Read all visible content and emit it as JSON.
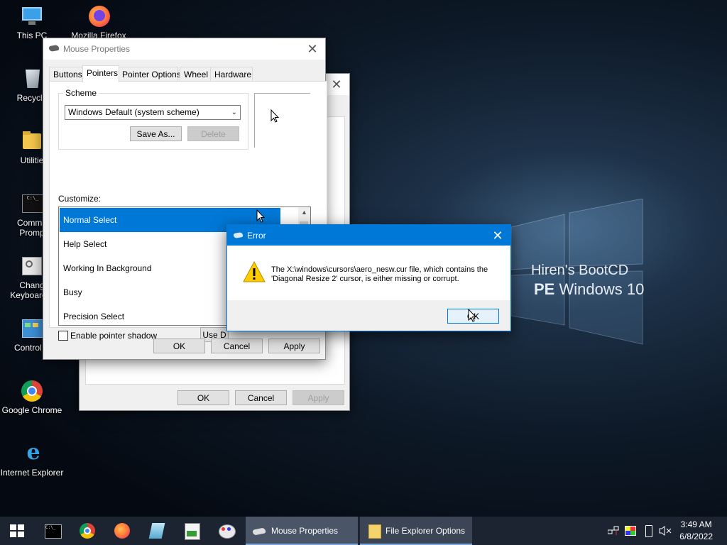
{
  "desktop": {
    "icons": [
      {
        "label": "This PC",
        "icon": "this-pc-icon"
      },
      {
        "label": "Mozilla Firefox",
        "icon": "firefox-icon"
      },
      {
        "label": "Recycle",
        "icon": "recycle-bin-icon"
      },
      {
        "label": "Utilitie",
        "icon": "folder-icon"
      },
      {
        "label": "Comma",
        "label2": "Promp",
        "icon": "command-prompt-icon"
      },
      {
        "label": "Chang",
        "label2": "Keyboard L",
        "icon": "keyboard-layout-icon"
      },
      {
        "label": "Control P",
        "icon": "control-panel-icon"
      },
      {
        "label": "Google Chrome",
        "icon": "chrome-icon"
      },
      {
        "label": "Internet Explorer",
        "icon": "ie-icon"
      }
    ],
    "branding": {
      "line1": "Hiren's BootCD",
      "line2_bold": "PE",
      "line2_rest": " Windows 10"
    }
  },
  "back_window": {
    "buttons": {
      "ok": "OK",
      "cancel": "Cancel",
      "apply": "Apply"
    }
  },
  "mouse_props": {
    "title": "Mouse Properties",
    "tabs": [
      "Buttons",
      "Pointers",
      "Pointer Options",
      "Wheel",
      "Hardware"
    ],
    "active_tab": "Pointers",
    "scheme_label": "Scheme",
    "scheme_value": "Windows Default (system scheme)",
    "save_as": "Save As...",
    "delete": "Delete",
    "customize_label": "Customize:",
    "list": [
      {
        "label": "Normal Select",
        "selected": true
      },
      {
        "label": "Help Select",
        "selected": false
      },
      {
        "label": "Working In Background",
        "selected": false
      },
      {
        "label": "Busy",
        "selected": false
      },
      {
        "label": "Precision Select",
        "selected": false
      }
    ],
    "enable_shadow": "Enable pointer shadow",
    "use_default": "Use D",
    "buttons": {
      "ok": "OK",
      "cancel": "Cancel",
      "apply": "Apply"
    }
  },
  "error_dialog": {
    "title": "Error",
    "message": "The X:\\windows\\cursors\\aero_nesw.cur file, which contains the 'Diagonal Resize 2' cursor, is either missing or corrupt.",
    "ok": "OK"
  },
  "taskbar": {
    "pinned": [
      "start-icon",
      "cmd-icon",
      "chrome-icon",
      "firefox-icon",
      "notepad-icon",
      "task-manager-icon",
      "paint-icon"
    ],
    "buttons": [
      {
        "label": "Mouse Properties",
        "icon": "mouse-icon"
      },
      {
        "label": "File Explorer Options",
        "icon": "folder-options-icon"
      }
    ],
    "time": "3:49 AM",
    "date": "6/8/2022"
  },
  "colors": {
    "accent": "#0078d7",
    "taskbar": "#1c2431"
  }
}
